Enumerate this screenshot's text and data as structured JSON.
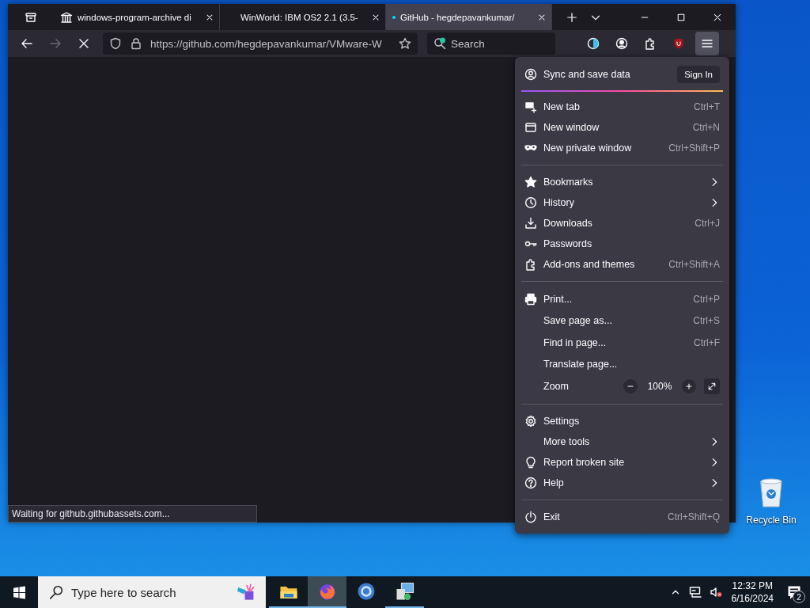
{
  "window": {
    "tabs": [
      {
        "title": "windows-program-archive di",
        "selected": false
      },
      {
        "title": "WinWorld: IBM OS2 2.1 (3.5-",
        "selected": false
      },
      {
        "title": "GitHub - hegdepavankumar/",
        "selected": true
      }
    ],
    "toolbar": {
      "url": "https://github.com/hegdepavankumar/VMware-W",
      "search_placeholder": "Search"
    },
    "status": "Waiting for github.githubassets.com..."
  },
  "menu": {
    "items": [
      {
        "kind": "account",
        "label": "Sync and save data",
        "button": "Sign In"
      },
      {
        "kind": "item",
        "label": "New tab",
        "shortcut": "Ctrl+T",
        "submenu": false
      },
      {
        "kind": "item",
        "label": "New window",
        "shortcut": "Ctrl+N",
        "submenu": false
      },
      {
        "kind": "item",
        "label": "New private window",
        "shortcut": "Ctrl+Shift+P",
        "submenu": false
      },
      {
        "kind": "separator"
      },
      {
        "kind": "item",
        "label": "Bookmarks",
        "submenu": true
      },
      {
        "kind": "item",
        "label": "History",
        "submenu": true
      },
      {
        "kind": "item",
        "label": "Downloads",
        "shortcut": "Ctrl+J",
        "submenu": false
      },
      {
        "kind": "item",
        "label": "Passwords",
        "submenu": false
      },
      {
        "kind": "item",
        "label": "Add-ons and themes",
        "shortcut": "Ctrl+Shift+A",
        "submenu": false
      },
      {
        "kind": "separator"
      },
      {
        "kind": "item",
        "label": "Print...",
        "shortcut": "Ctrl+P",
        "submenu": false
      },
      {
        "kind": "item",
        "label": "Save page as...",
        "shortcut": "Ctrl+S",
        "submenu": false
      },
      {
        "kind": "item",
        "label": "Find in page...",
        "shortcut": "Ctrl+F",
        "submenu": false
      },
      {
        "kind": "item",
        "label": "Translate page...",
        "submenu": false
      },
      {
        "kind": "zoom",
        "label": "Zoom",
        "value": "100%"
      },
      {
        "kind": "separator"
      },
      {
        "kind": "item",
        "label": "Settings",
        "submenu": false
      },
      {
        "kind": "item",
        "label": "More tools",
        "submenu": true
      },
      {
        "kind": "item",
        "label": "Report broken site",
        "submenu": true
      },
      {
        "kind": "item",
        "label": "Help",
        "submenu": true
      },
      {
        "kind": "separator"
      },
      {
        "kind": "item",
        "label": "Exit",
        "shortcut": "Ctrl+Shift+Q",
        "submenu": false
      }
    ]
  },
  "desktop_icons": [
    {
      "label": "Recycle Bin"
    }
  ],
  "taskbar": {
    "search_placeholder": "Type here to search",
    "apps": [
      {
        "selected": false,
        "running": true
      },
      {
        "selected": true,
        "running": true
      },
      {
        "selected": false,
        "running": false
      },
      {
        "selected": false,
        "running": true
      }
    ],
    "time": "12:32 PM",
    "date": "6/16/2024",
    "notifications": "2"
  }
}
